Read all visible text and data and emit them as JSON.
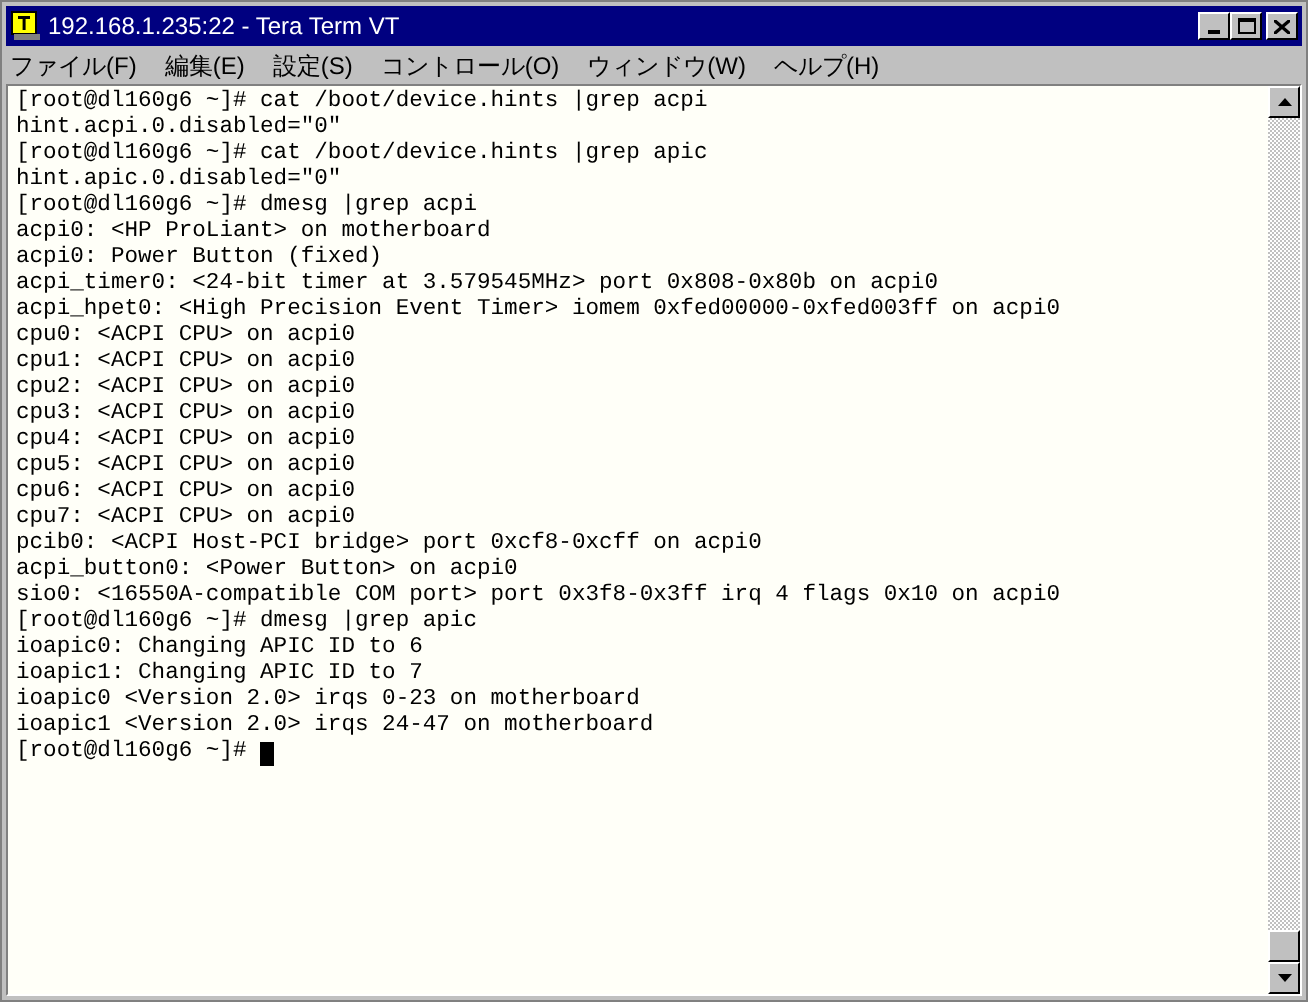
{
  "window": {
    "title": "192.168.1.235:22 - Tera Term VT"
  },
  "menu": [
    "ファイル(F)",
    "編集(E)",
    "設定(S)",
    "コントロール(O)",
    "ウィンドウ(W)",
    "ヘルプ(H)"
  ],
  "terminal": {
    "lines": [
      "[root@dl160g6 ~]# cat /boot/device.hints |grep acpi",
      "hint.acpi.0.disabled=\"0\"",
      "[root@dl160g6 ~]# cat /boot/device.hints |grep apic",
      "hint.apic.0.disabled=\"0\"",
      "[root@dl160g6 ~]# dmesg |grep acpi",
      "acpi0: <HP ProLiant> on motherboard",
      "acpi0: Power Button (fixed)",
      "acpi_timer0: <24-bit timer at 3.579545MHz> port 0x808-0x80b on acpi0",
      "acpi_hpet0: <High Precision Event Timer> iomem 0xfed00000-0xfed003ff on acpi0",
      "cpu0: <ACPI CPU> on acpi0",
      "cpu1: <ACPI CPU> on acpi0",
      "cpu2: <ACPI CPU> on acpi0",
      "cpu3: <ACPI CPU> on acpi0",
      "cpu4: <ACPI CPU> on acpi0",
      "cpu5: <ACPI CPU> on acpi0",
      "cpu6: <ACPI CPU> on acpi0",
      "cpu7: <ACPI CPU> on acpi0",
      "pcib0: <ACPI Host-PCI bridge> port 0xcf8-0xcff on acpi0",
      "acpi_button0: <Power Button> on acpi0",
      "sio0: <16550A-compatible COM port> port 0x3f8-0x3ff irq 4 flags 0x10 on acpi0",
      "[root@dl160g6 ~]# dmesg |grep apic",
      "ioapic0: Changing APIC ID to 6",
      "ioapic1: Changing APIC ID to 7",
      "ioapic0 <Version 2.0> irqs 0-23 on motherboard",
      "ioapic1 <Version 2.0> irqs 24-47 on motherboard"
    ],
    "prompt": "[root@dl160g6 ~]# "
  }
}
